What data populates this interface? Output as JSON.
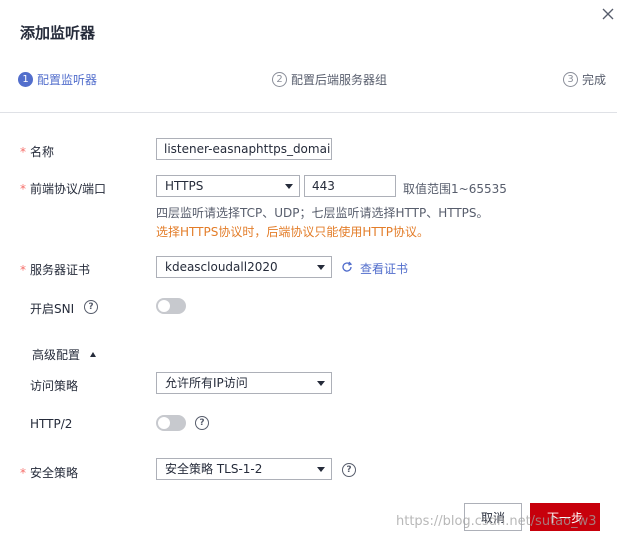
{
  "dialog": {
    "title": "添加监听器"
  },
  "steps": [
    {
      "num": "1",
      "label": "配置监听器"
    },
    {
      "num": "2",
      "label": "配置后端服务器组"
    },
    {
      "num": "3",
      "label": "完成"
    }
  ],
  "form": {
    "name": {
      "label": "名称",
      "value": "listener-easnaphttps_domains"
    },
    "protocol_port": {
      "label": "前端协议/端口",
      "protocol": "HTTPS",
      "port": "443",
      "range_hint": "取值范围1~65535",
      "hint": "四层监听请选择TCP、UDP；七层监听请选择HTTP、HTTPS。",
      "warning": "选择HTTPS协议时，后端协议只能使用HTTP协议。"
    },
    "certificate": {
      "label": "服务器证书",
      "value": "kdeascloudall2020",
      "view_link": "查看证书"
    },
    "sni": {
      "label": "开启SNI"
    },
    "advanced": {
      "label": "高级配置"
    },
    "access_policy": {
      "label": "访问策略",
      "value": "允许所有IP访问"
    },
    "http2": {
      "label": "HTTP/2"
    },
    "security_policy": {
      "label": "安全策略",
      "value": "安全策略 TLS-1-2"
    }
  },
  "buttons": {
    "cancel": "取消",
    "next": "下一步"
  },
  "watermark": "https://blog.csdn.net/sutao_w3",
  "colors": {
    "primary": "#526ecc",
    "required": "#f66f6a",
    "warning": "#e37d29",
    "next_button": "#c7000b"
  }
}
